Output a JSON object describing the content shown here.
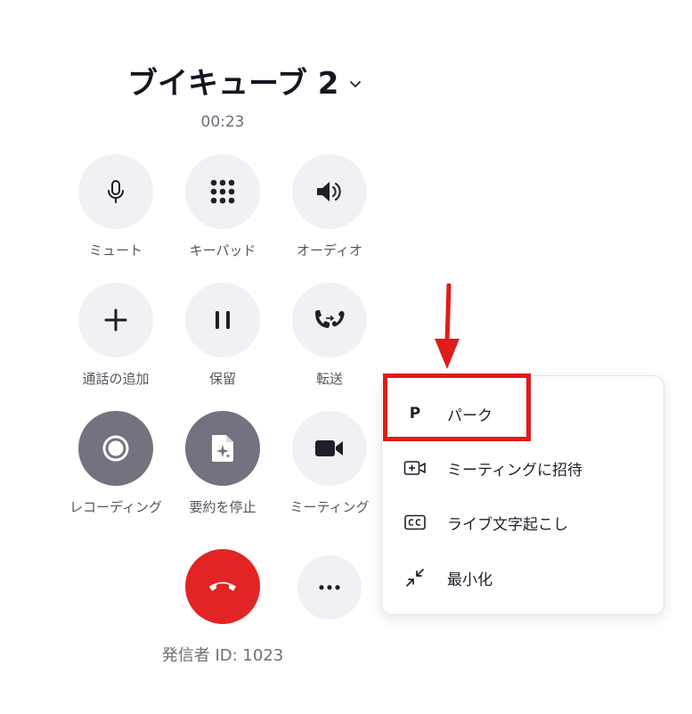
{
  "call": {
    "title": "ブイキューブ 2",
    "timer": "00:23",
    "caller_id": "発信者 ID: 1023"
  },
  "controls": {
    "mute": "ミュート",
    "keypad": "キーパッド",
    "audio": "オーディオ",
    "add_call": "通話の追加",
    "hold": "保留",
    "transfer": "転送",
    "recording": "レコーディング",
    "stop_summary": "要約を停止",
    "meeting": "ミーティング"
  },
  "menu": {
    "park_icon_letter": "P",
    "park": "パーク",
    "invite_meeting": "ミーティングに招待",
    "live_caption": "ライブ文字起こし",
    "minimize": "最小化"
  },
  "colors": {
    "annotation_red": "#e11b1b",
    "end_call_red": "#e32424",
    "button_bg": "#f1f0f5",
    "button_dark_bg": "#73737f"
  }
}
